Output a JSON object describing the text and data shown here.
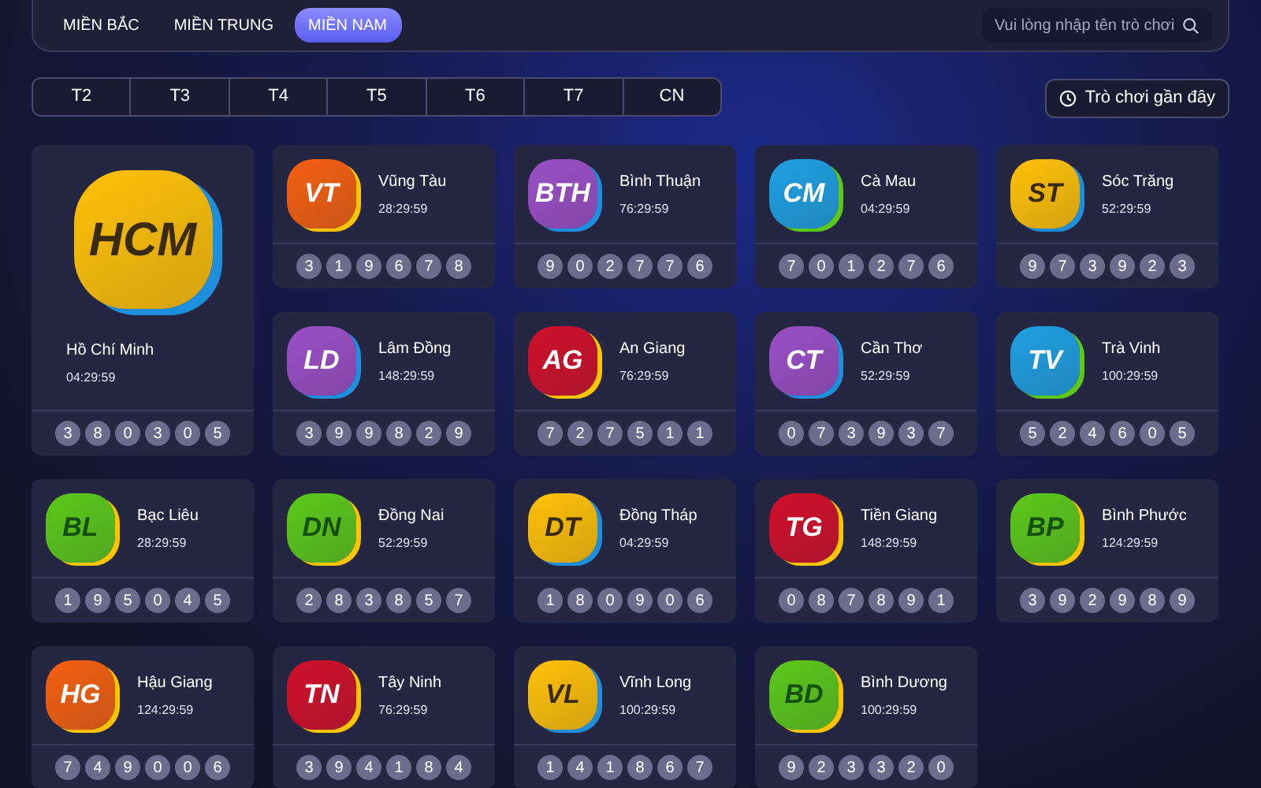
{
  "regions": [
    {
      "label": "MIỀN BẮC",
      "selected": false
    },
    {
      "label": "MIỀN TRUNG",
      "selected": false
    },
    {
      "label": "MIỀN NAM",
      "selected": true
    }
  ],
  "search": {
    "placeholder": "Vui lòng nhập tên trò chơi"
  },
  "days": [
    {
      "label": "T2",
      "selected": false
    },
    {
      "label": "T3",
      "selected": false
    },
    {
      "label": "T4",
      "selected": false
    },
    {
      "label": "T5",
      "selected": false
    },
    {
      "label": "T6",
      "selected": false
    },
    {
      "label": "T7",
      "selected": false
    },
    {
      "label": "CN",
      "selected": false
    }
  ],
  "recent_button": "Trò chơi gần đây",
  "games": [
    {
      "code": "HCM",
      "name": "Hồ Chí Minh",
      "time": "04:29:59",
      "color": "#ffc107",
      "featured": true,
      "numbers": [
        "3",
        "8",
        "0",
        "3",
        "0",
        "5"
      ]
    },
    {
      "code": "VT",
      "name": "Vũng Tàu",
      "time": "28:29:59",
      "color": "#f4600f",
      "numbers": [
        "3",
        "1",
        "9",
        "6",
        "7",
        "8"
      ]
    },
    {
      "code": "BTH",
      "name": "Bình Thuận",
      "time": "76:29:59",
      "color": "#9b4fc4",
      "numbers": [
        "9",
        "0",
        "2",
        "7",
        "7",
        "6"
      ]
    },
    {
      "code": "CM",
      "name": "Cà Mau",
      "time": "04:29:59",
      "color": "#1fa0e0",
      "numbers": [
        "7",
        "0",
        "1",
        "2",
        "7",
        "6"
      ]
    },
    {
      "code": "ST",
      "name": "Sóc Trăng",
      "time": "52:29:59",
      "color": "#ffc107",
      "numbers": [
        "9",
        "7",
        "3",
        "9",
        "2",
        "3"
      ]
    },
    {
      "code": "LD",
      "name": "Lâm Đồng",
      "time": "148:29:59",
      "color": "#9b4fc4",
      "numbers": [
        "3",
        "9",
        "9",
        "8",
        "2",
        "9"
      ]
    },
    {
      "code": "AG",
      "name": "An Giang",
      "time": "76:29:59",
      "color": "#d0102a",
      "numbers": [
        "7",
        "2",
        "7",
        "5",
        "1",
        "1"
      ]
    },
    {
      "code": "CT",
      "name": "Cần Thơ",
      "time": "52:29:59",
      "color": "#9b4fc4",
      "numbers": [
        "0",
        "7",
        "3",
        "9",
        "3",
        "7"
      ]
    },
    {
      "code": "TV",
      "name": "Trà Vinh",
      "time": "100:29:59",
      "color": "#1fa0e0",
      "numbers": [
        "5",
        "2",
        "4",
        "6",
        "0",
        "5"
      ]
    },
    {
      "code": "BL",
      "name": "Bạc Liêu",
      "time": "28:29:59",
      "color": "#5cc81a",
      "numbers": [
        "1",
        "9",
        "5",
        "0",
        "4",
        "5"
      ]
    },
    {
      "code": "DN",
      "name": "Đồng Nai",
      "time": "52:29:59",
      "color": "#5cc81a",
      "numbers": [
        "2",
        "8",
        "3",
        "8",
        "5",
        "7"
      ]
    },
    {
      "code": "DT",
      "name": "Đồng Tháp",
      "time": "04:29:59",
      "color": "#ffc107",
      "numbers": [
        "1",
        "8",
        "0",
        "9",
        "0",
        "6"
      ]
    },
    {
      "code": "TG",
      "name": "Tiền Giang",
      "time": "148:29:59",
      "color": "#d0102a",
      "numbers": [
        "0",
        "8",
        "7",
        "8",
        "9",
        "1"
      ]
    },
    {
      "code": "BP",
      "name": "Bình Phước",
      "time": "124:29:59",
      "color": "#5cc81a",
      "numbers": [
        "3",
        "9",
        "2",
        "9",
        "8",
        "9"
      ]
    },
    {
      "code": "HG",
      "name": "Hậu Giang",
      "time": "124:29:59",
      "color": "#f4600f",
      "numbers": [
        "7",
        "4",
        "9",
        "0",
        "0",
        "6"
      ]
    },
    {
      "code": "TN",
      "name": "Tây Ninh",
      "time": "76:29:59",
      "color": "#d0102a",
      "numbers": [
        "3",
        "9",
        "4",
        "1",
        "8",
        "4"
      ]
    },
    {
      "code": "VL",
      "name": "Vĩnh Long",
      "time": "100:29:59",
      "color": "#ffc107",
      "numbers": [
        "1",
        "4",
        "1",
        "8",
        "6",
        "7"
      ]
    },
    {
      "code": "BD",
      "name": "Bình Dương",
      "time": "100:29:59",
      "color": "#5cc81a",
      "numbers": [
        "9",
        "2",
        "3",
        "3",
        "2",
        "0"
      ]
    }
  ]
}
